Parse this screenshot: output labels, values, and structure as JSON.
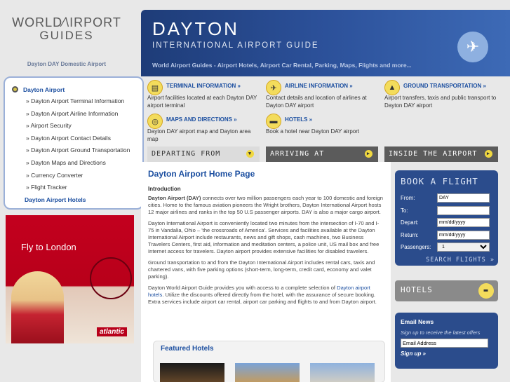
{
  "logo": {
    "line1": "WORLD⁄\\IRPORT",
    "line2": "GUIDES",
    "subtitle": "Dayton DAY Domestic Airport"
  },
  "header": {
    "title": "DAYTON",
    "subtitle": "INTERNATIONAL AIRPORT GUIDE",
    "tagline": "World Airport Guides - Airport Hotels, Airport Car Rental, Parking, Maps, Flights and more...",
    "icon": "airplane-icon"
  },
  "sidebar": {
    "head": "Dayton Airport",
    "items": [
      "» Dayton Airport Terminal Information",
      "» Dayton Airport Airline Information",
      "» Airport Security",
      "» Dayton Airport Contact Details",
      "» Dayton Airport Ground Transportation",
      "» Dayton Maps and Directions",
      "» Currency Converter",
      "» Flight Tracker"
    ],
    "tail": "Dayton Airport Hotels"
  },
  "ad": {
    "text": "Fly to London",
    "brand": "atlantic"
  },
  "services": [
    {
      "title": "TERMINAL INFORMATION »",
      "desc": "Airport facilities located at each Dayton DAY airport terminal",
      "icon": "terminal-icon"
    },
    {
      "title": "AIRLINE INFORMATION »",
      "desc": "Contact details and location of airlines at Dayton DAY airport",
      "icon": "plane-icon"
    },
    {
      "title": "GROUND TRANSPORTATION »",
      "desc": "Airport transfers, taxis and public transport to Dayton DAY airport",
      "icon": "car-icon"
    },
    {
      "title": "MAPS AND DIRECTIONS »",
      "desc": "Dayton DAY airport map and Dayton area map",
      "icon": "compass-icon"
    },
    {
      "title": "HOTELS »",
      "desc": "Book a hotel near Dayton DAY airport",
      "icon": "bed-icon"
    }
  ],
  "tabs": [
    "DEPARTING FROM",
    "ARRIVING AT",
    "INSIDE THE AIRPORT"
  ],
  "main": {
    "title": "Dayton Airport Home Page",
    "intro_heading": "Introduction",
    "p1_bold": "Dayton Airport (DAY)",
    "p1_rest": " connects over two million passengers each year to 100 domestic and foreign cities. Home to the famous aviation pioneers the Wright brothers, Dayton International Airport hosts 12 major airlines and ranks in the top 50 U.S passenger airports. DAY is also a major cargo airport.",
    "p2": "Dayton International Airport is conveniently located two minutes from the intersection of I-70 and I-75 in Vandalia, Ohio – 'the crossroads of America'. Services and facilities available at the Dayton International Airport include restaurants, news and gift shops, cash machines, two Business Travelers Centers, first aid, information and meditation centers, a police unit, US mail box and free Internet access for travelers. Dayton airport provides extensive facilities for disabled travelers.",
    "p3": "Ground transportation to and from the Dayton International Airport includes rental cars, taxis and chartered vans, with five parking options (short-term, long-term, credit card, economy and valet parking).",
    "p4_a": "Dayton World Airport Guide provides you with access to a complete selection of ",
    "p4_link": "Dayton airport hotels",
    "p4_b": ". Utilize the discounts offered directly from the hotel, with the assurance of secure booking. Extra services include airport car rental, airport car parking and flights to and from Dayton airport.",
    "featured": "Featured Hotels"
  },
  "booking": {
    "title": "BOOK A FLIGHT",
    "from_label": "From:",
    "from_value": "DAY",
    "to_label": "To:",
    "to_value": "",
    "depart_label": "Depart:",
    "depart_value": "mm/dd/yyyy",
    "return_label": "Return:",
    "return_value": "mm/dd/yyyy",
    "passengers_label": "Passengers:",
    "passengers_value": "1",
    "search": "SEARCH FLIGHTS »"
  },
  "hotels_box": {
    "label": "HOTELS"
  },
  "email": {
    "title": "Email News",
    "subtitle": "Sign up to receive the latest offers",
    "value": "Email Address",
    "signup": "Sign up »"
  }
}
